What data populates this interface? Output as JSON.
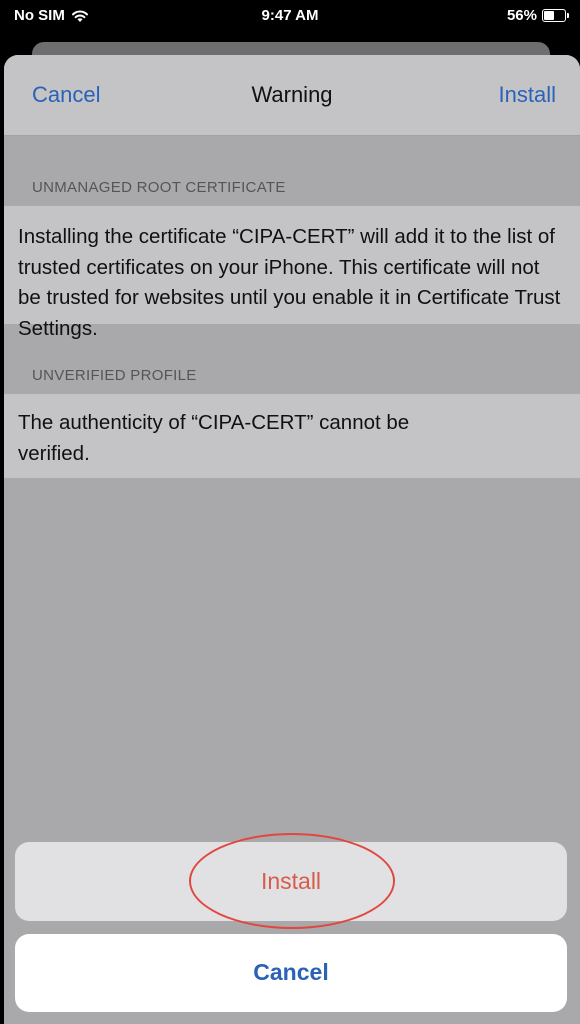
{
  "status_bar": {
    "carrier": "No SIM",
    "time": "9:47 AM",
    "battery_percent": "56%",
    "battery_level": 0.56,
    "wifi_icon": "wifi-icon"
  },
  "nav": {
    "cancel": "Cancel",
    "title": "Warning",
    "install": "Install"
  },
  "sections": [
    {
      "header": "UNMANAGED ROOT CERTIFICATE",
      "body": "Installing the certificate “CIPA-CERT” will add it to the list of trusted certificates on your iPhone. This certificate will not be trusted for websites until you enable it in Certificate Trust Settings."
    },
    {
      "header": "UNVERIFIED PROFILE",
      "body": "The authenticity of “CIPA-CERT” cannot be verified."
    }
  ],
  "action_sheet": {
    "install": "Install",
    "cancel": "Cancel"
  },
  "colors": {
    "link_blue": "#2a62b8",
    "destructive_red": "#d85c4b",
    "highlight_red": "#e14740"
  }
}
